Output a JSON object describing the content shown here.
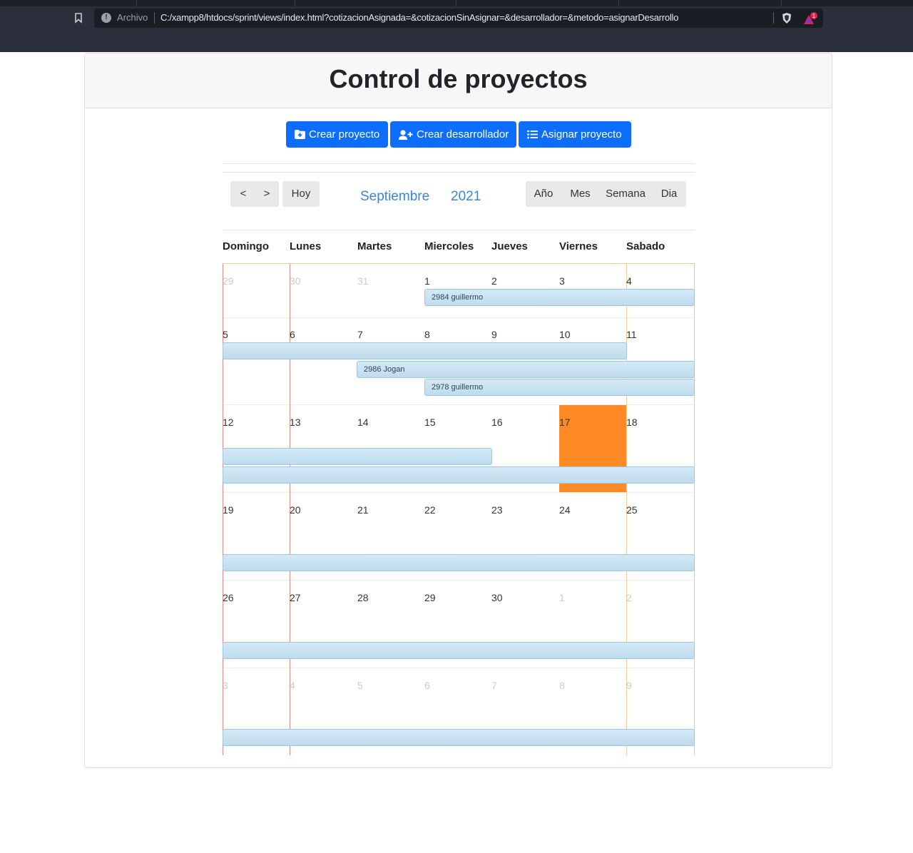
{
  "browser": {
    "protocol_label": "Archivo",
    "url": "C:/xampp8/htdocs/sprint/views/index.html?cotizacionAsignada=&cotizacionSinAsignar=&desarrollador=&metodo=asignarDesarrollo",
    "rewards_badge": "1"
  },
  "header": {
    "title": "Control de proyectos"
  },
  "actions": {
    "create_project": "Crear proyecto",
    "create_developer": "Crear desarrollador",
    "assign_project": "Asignar proyecto"
  },
  "calendar": {
    "nav": {
      "prev": "<",
      "next": ">",
      "today": "Hoy"
    },
    "month": "Septiembre",
    "year": "2021",
    "views": {
      "year": "Año",
      "month": "Mes",
      "week": "Semana",
      "day": "Dia"
    },
    "day_names": [
      "Domingo",
      "Lunes",
      "Martes",
      "Miercoles",
      "Jueves",
      "Viernes",
      "Sabado"
    ],
    "weeks": [
      [
        "29",
        "30",
        "31",
        "1",
        "2",
        "3",
        "4"
      ],
      [
        "5",
        "6",
        "7",
        "8",
        "9",
        "10",
        "11"
      ],
      [
        "12",
        "13",
        "14",
        "15",
        "16",
        "17",
        "18"
      ],
      [
        "19",
        "20",
        "21",
        "22",
        "23",
        "24",
        "25"
      ],
      [
        "26",
        "27",
        "28",
        "29",
        "30",
        "1",
        "2"
      ],
      [
        "3",
        "4",
        "5",
        "6",
        "7",
        "8",
        "9"
      ]
    ],
    "events": {
      "e1": "2984 guillermo",
      "e2": "2986 Jogan",
      "e3": "2978 guillermo"
    }
  },
  "colors": {
    "primary": "#0d6efd",
    "today": "#ff8a24",
    "event_bg": "#cfe6f3",
    "month_text": "#3a86d4"
  }
}
